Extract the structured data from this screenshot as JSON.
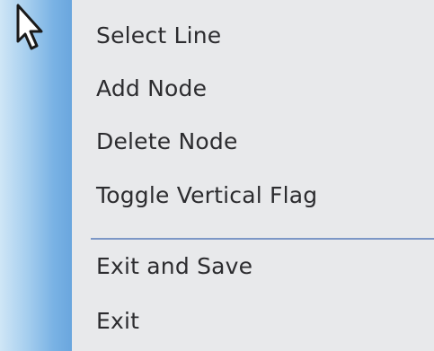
{
  "context_menu": {
    "cursor_icon": "arrow-cursor-icon",
    "gutter_color": "#79b2e4",
    "separator_color": "#7c97c6",
    "items": [
      {
        "label": "Select Line"
      },
      {
        "label": "Add Node"
      },
      {
        "label": "Delete Node"
      },
      {
        "label": "Toggle Vertical Flag"
      },
      {
        "label": "Exit and Save"
      },
      {
        "label": "Exit"
      }
    ]
  }
}
